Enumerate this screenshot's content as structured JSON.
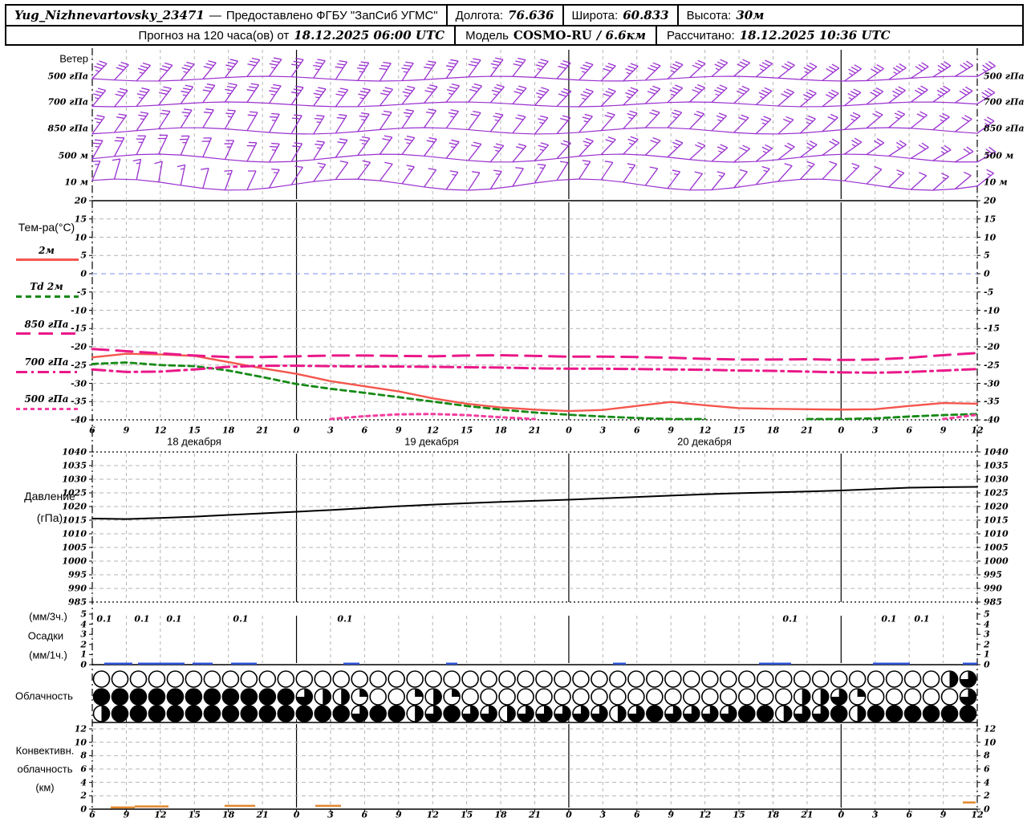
{
  "colors": {
    "wind_barbs": "#9a30d0",
    "temp_2m": "#f4564e",
    "dewpoint": "#168a16",
    "temp_850": "#ea1889",
    "temp_700": "#ea1889",
    "temp_500": "#f23fa0",
    "pressure": "#000000",
    "precip": "#2b4fd8",
    "convective": "#e2862c",
    "grid": "#b4b4b4",
    "zero_line": "#7a8df0",
    "axis": "#000000"
  },
  "header": {
    "station": "Yug_Nizhnevartovsky_23471",
    "dash": "—",
    "provided_by": "Предоставлено ФГБУ \"ЗапСиб УГМС\"",
    "lon_label": "Долгота:",
    "lon": "76.636",
    "lat_label": "Широта:",
    "lat": "60.833",
    "alt_label": "Высота:",
    "alt": "30м",
    "forecast_label": "Прогноз на 120 часа(ов) от",
    "forecast_time": "18.12.2025 06:00 UTC",
    "model_label": "Модель",
    "model": "COSMO-RU",
    "model_res": "/ 6.6км",
    "calc_label": "Рассчитано:",
    "calc_time": "18.12.2025 10:36 UTC"
  },
  "time_axis": {
    "ticks": [
      "6",
      "9",
      "12",
      "15",
      "18",
      "21",
      "0",
      "3",
      "6",
      "9",
      "12",
      "15",
      "18",
      "21",
      "0",
      "3",
      "6",
      "9",
      "12",
      "15",
      "18",
      "21",
      "0",
      "3",
      "6",
      "9",
      "12"
    ],
    "dates": [
      {
        "label": "18 декабря",
        "x": 242
      },
      {
        "label": "19 декабря",
        "x": 538
      },
      {
        "label": "20 декабря",
        "x": 878
      }
    ]
  },
  "chart_data": [
    {
      "id": "temperature",
      "type": "line",
      "title": "Тем-ра(°C)",
      "ylim": [
        -40,
        20
      ],
      "yticks": [
        20,
        15,
        10,
        5,
        0,
        -5,
        -10,
        -15,
        -20,
        -25,
        -30,
        -35,
        -40
      ],
      "x_hours": [
        "6",
        "9",
        "12",
        "15",
        "18",
        "21",
        "0",
        "3",
        "6",
        "9",
        "12",
        "15",
        "18",
        "21",
        "0",
        "3",
        "6",
        "9",
        "12",
        "15",
        "18",
        "21",
        "0",
        "3",
        "6",
        "9",
        "12"
      ],
      "series": [
        {
          "name": "2м",
          "style": "solid",
          "color": "#f4564e",
          "values": [
            -22.9,
            -21.9,
            -22.1,
            -22.5,
            -24.2,
            -25.9,
            -27.4,
            -29.4,
            -30.8,
            -32.2,
            -34.1,
            -35.6,
            -36.6,
            -37.2,
            -37.6,
            -37.3,
            -36.2,
            -35.1,
            -36.0,
            -36.8,
            -37.0,
            -37.1,
            -37.2,
            -37.1,
            -36.2,
            -35.4,
            -35.6
          ]
        },
        {
          "name": "Td  2м",
          "style": "dash",
          "color": "#168a16",
          "values": [
            -24.7,
            -24.3,
            -25.0,
            -25.3,
            -26.5,
            -28.3,
            -30.2,
            -31.5,
            -32.6,
            -33.8,
            -35.0,
            -36.2,
            -37.2,
            -38.0,
            -38.6,
            -39.1,
            -39.5,
            -39.8,
            -40.0,
            null,
            null,
            -40.0,
            -39.9,
            -39.6,
            -39.1,
            -38.7,
            -38.4
          ]
        },
        {
          "name": "850 гПа",
          "style": "longdash",
          "color": "#ea1889",
          "values": [
            -20.6,
            -21.2,
            -21.8,
            -22.4,
            -22.8,
            -22.8,
            -22.6,
            -22.4,
            -22.4,
            -22.5,
            -22.6,
            -22.4,
            -22.3,
            -22.5,
            -22.7,
            -22.7,
            -22.8,
            -23.0,
            -23.3,
            -23.5,
            -23.5,
            -23.4,
            -23.6,
            -23.5,
            -23.0,
            -22.3,
            -21.7
          ]
        },
        {
          "name": "700 гПа",
          "style": "dashdot",
          "color": "#ea1889",
          "values": [
            -26.2,
            -26.9,
            -26.8,
            -26.2,
            -25.5,
            -25.2,
            -25.2,
            -25.3,
            -25.4,
            -25.4,
            -25.5,
            -25.6,
            -25.7,
            -25.9,
            -26.0,
            -26.0,
            -26.1,
            -26.2,
            -26.3,
            -26.5,
            -26.6,
            -26.8,
            -27.0,
            -27.1,
            -26.9,
            -26.5,
            -26.1
          ]
        },
        {
          "name": "500 гПа",
          "style": "dots",
          "color": "#f23fa0",
          "values": [
            null,
            null,
            null,
            null,
            null,
            null,
            null,
            -39.8,
            -39.0,
            -38.5,
            -38.4,
            -38.7,
            -39.3,
            -39.9,
            null,
            null,
            null,
            null,
            null,
            null,
            null,
            null,
            null,
            null,
            null,
            -39.9,
            -38.6
          ]
        }
      ]
    },
    {
      "id": "pressure",
      "type": "line",
      "ylabel": "Давление",
      "unit": "(гПа)",
      "ylim": [
        985,
        1040
      ],
      "yticks": [
        1040,
        1035,
        1030,
        1025,
        1020,
        1015,
        1010,
        1005,
        1000,
        995,
        990,
        985
      ],
      "values": [
        1015.6,
        1015.4,
        1015.8,
        1016.3,
        1016.9,
        1017.5,
        1018.1,
        1018.7,
        1019.4,
        1020.1,
        1020.7,
        1021.2,
        1021.7,
        1022.1,
        1022.5,
        1023.0,
        1023.5,
        1024.0,
        1024.5,
        1024.9,
        1025.2,
        1025.5,
        1025.9,
        1026.4,
        1026.9,
        1027.1,
        1027.2
      ]
    },
    {
      "id": "precipitation",
      "type": "bar",
      "unit3h": "(мм/3ч.)",
      "ylabel": "Осадки",
      "unit1h": "(мм/1ч.)",
      "ylim": [
        0,
        5
      ],
      "yticks": [
        5,
        4,
        3,
        2,
        1,
        0
      ],
      "amount_label": "0.1",
      "labels_x": [
        130,
        177,
        217,
        300,
        430,
        985,
        1108,
        1149
      ],
      "bars": [
        [
          130,
          165,
          0.1
        ],
        [
          172,
          230,
          0.12
        ],
        [
          240,
          265,
          0.1
        ],
        [
          288,
          320,
          0.1
        ],
        [
          428,
          448,
          0.1
        ],
        [
          556,
          570,
          0.05
        ],
        [
          764,
          780,
          0.05
        ],
        [
          946,
          986,
          0.1
        ],
        [
          1088,
          1134,
          0.1
        ],
        [
          1200,
          1218,
          0.1
        ]
      ]
    },
    {
      "id": "cloudiness",
      "type": "symbols",
      "title": "Облачность",
      "rows": [
        [
          0,
          0,
          0,
          0,
          0,
          0,
          0,
          0,
          0,
          0,
          0,
          0,
          0,
          0,
          0,
          0,
          0,
          0,
          0,
          0,
          0,
          0,
          0,
          0,
          0,
          0,
          0,
          0,
          0,
          0,
          0,
          0,
          0,
          0,
          0,
          0,
          0,
          0,
          0,
          0,
          0,
          0,
          0,
          0,
          0,
          0,
          0.5,
          0.75
        ],
        [
          1,
          1,
          1,
          1,
          1,
          1,
          1,
          1,
          1,
          1,
          1,
          0.75,
          0.5,
          0.5,
          0.25,
          0,
          0,
          0.25,
          0.5,
          0.25,
          0,
          0,
          0,
          0,
          0,
          0,
          0,
          0,
          0,
          0,
          0,
          0,
          0,
          0,
          0,
          0,
          0,
          0,
          0.5,
          0.5,
          0.75,
          0.25,
          0,
          0,
          0,
          0,
          0,
          0.75
        ],
        [
          0.5,
          1,
          1,
          1,
          1,
          1,
          1,
          1,
          1,
          1,
          1,
          1,
          1,
          1,
          0.75,
          1,
          1,
          0.5,
          0.75,
          1,
          0.75,
          0.75,
          0.5,
          0.75,
          0.75,
          0.75,
          0.75,
          0.75,
          0.5,
          0.75,
          1,
          0.75,
          0.75,
          0.75,
          0.75,
          1,
          1,
          0.5,
          0.75,
          0.75,
          1,
          0.5,
          1,
          1,
          1,
          1,
          1,
          1
        ]
      ]
    },
    {
      "id": "convective",
      "type": "segments",
      "title1": "Конвективн.",
      "title2": "облачность",
      "unit": "(км)",
      "ylim": [
        0,
        12
      ],
      "yticks": [
        12,
        10,
        8,
        6,
        4,
        2,
        0
      ],
      "segments": [
        [
          138,
          168,
          0.25
        ],
        [
          168,
          210,
          0.4
        ],
        [
          280,
          318,
          0.5
        ],
        [
          393,
          425,
          0.5
        ],
        [
          1200,
          1216,
          1.0
        ]
      ]
    },
    {
      "id": "wind",
      "type": "wind-barbs",
      "title": "Ветер",
      "rows": [
        {
          "level": "500 гПа",
          "base": 98,
          "amp": 3,
          "phase": 0,
          "feathers": 3,
          "angles": [
            44,
            43,
            42,
            41,
            40,
            39,
            38,
            37,
            36,
            35,
            34,
            33,
            32,
            32,
            33,
            34,
            35,
            36,
            37,
            38,
            40,
            41,
            42,
            44,
            45,
            46,
            47,
            48,
            49,
            50,
            51,
            52,
            52,
            53,
            54,
            55,
            56,
            57,
            58,
            59,
            60
          ]
        },
        {
          "level": "700 гПа",
          "base": 130,
          "amp": 3,
          "phase": 1,
          "feathers": 3,
          "angles": [
            40,
            39,
            38,
            37,
            36,
            35,
            35,
            34,
            34,
            35,
            36,
            36,
            37,
            38,
            38,
            39,
            39,
            40,
            41,
            41,
            42,
            43,
            43,
            44,
            45,
            45,
            46,
            47,
            47,
            48,
            49,
            49,
            50,
            51,
            51,
            52,
            53,
            54,
            55,
            56,
            57
          ]
        },
        {
          "level": "850 гПа",
          "base": 163,
          "amp": 4,
          "phase": 2,
          "feathers": 2,
          "angles": [
            36,
            35,
            34,
            33,
            32,
            31,
            30,
            30,
            29,
            30,
            31,
            32,
            33,
            34,
            34,
            35,
            36,
            36,
            37,
            38,
            39,
            40,
            40,
            41,
            42,
            43,
            43,
            44,
            45,
            45,
            46,
            47,
            47,
            48,
            49,
            50,
            50,
            51,
            52,
            53,
            54
          ]
        },
        {
          "level": "500 м",
          "base": 197,
          "amp": 5,
          "phase": 3,
          "feathers": 2,
          "angles": [
            30,
            28,
            26,
            25,
            24,
            24,
            25,
            27,
            29,
            31,
            32,
            34,
            35,
            36,
            37,
            37,
            38,
            38,
            39,
            40,
            41,
            42,
            43,
            44,
            45,
            46,
            47,
            48,
            49,
            50,
            51,
            52,
            53,
            54,
            55,
            56,
            57,
            58,
            59,
            60,
            61
          ]
        },
        {
          "level": "10 м",
          "base": 230,
          "amp": 7,
          "phase": 4,
          "feathers": 1,
          "angles": [
            22,
            16,
            12,
            10,
            12,
            16,
            20,
            25,
            29,
            33,
            35,
            36,
            37,
            37,
            36,
            35,
            34,
            33,
            32,
            31,
            31,
            32,
            33,
            34,
            35,
            36,
            37,
            38,
            39,
            40,
            41,
            42,
            43,
            44,
            45,
            46,
            47,
            48,
            49,
            50,
            52
          ]
        }
      ]
    }
  ]
}
